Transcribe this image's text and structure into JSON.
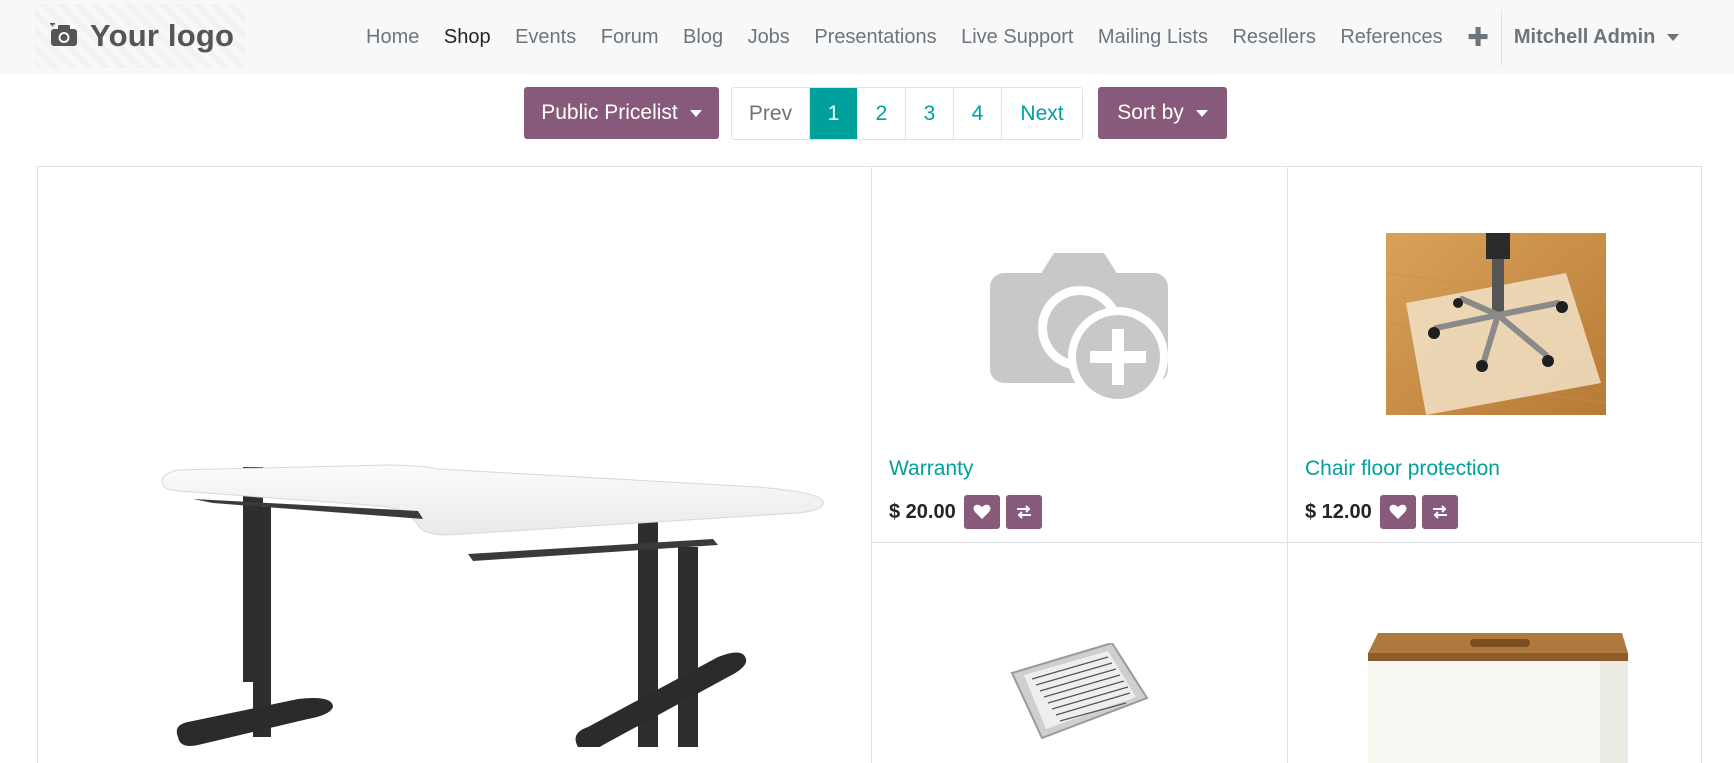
{
  "brand": {
    "logo_text": "Your logo",
    "accent": "#875a7b",
    "link": "#00a09d"
  },
  "nav": {
    "items": [
      "Home",
      "Shop",
      "Events",
      "Forum",
      "Blog",
      "Jobs",
      "Presentations",
      "Live Support",
      "Mailing Lists",
      "Resellers",
      "References"
    ],
    "active": "Shop",
    "add_icon": "plus-icon",
    "user": "Mitchell Admin"
  },
  "toolbar": {
    "pricelist_label": "Public Pricelist",
    "sort_label": "Sort by",
    "pager": {
      "prev": "Prev",
      "pages": [
        "1",
        "2",
        "3",
        "4"
      ],
      "current": "1",
      "next": "Next"
    }
  },
  "products": [
    {
      "name": "",
      "price": "",
      "image": "corner-desk-image"
    },
    {
      "name": "Warranty",
      "price": "$ 20.00",
      "image": "camera-placeholder-icon"
    },
    {
      "name": "Chair floor protection",
      "price": "$ 12.00",
      "image": "chair-floor-mat-image"
    },
    {
      "name": "",
      "price": "",
      "image": "ebook-reader-image"
    },
    {
      "name": "",
      "price": "",
      "image": "storage-box-image"
    }
  ]
}
